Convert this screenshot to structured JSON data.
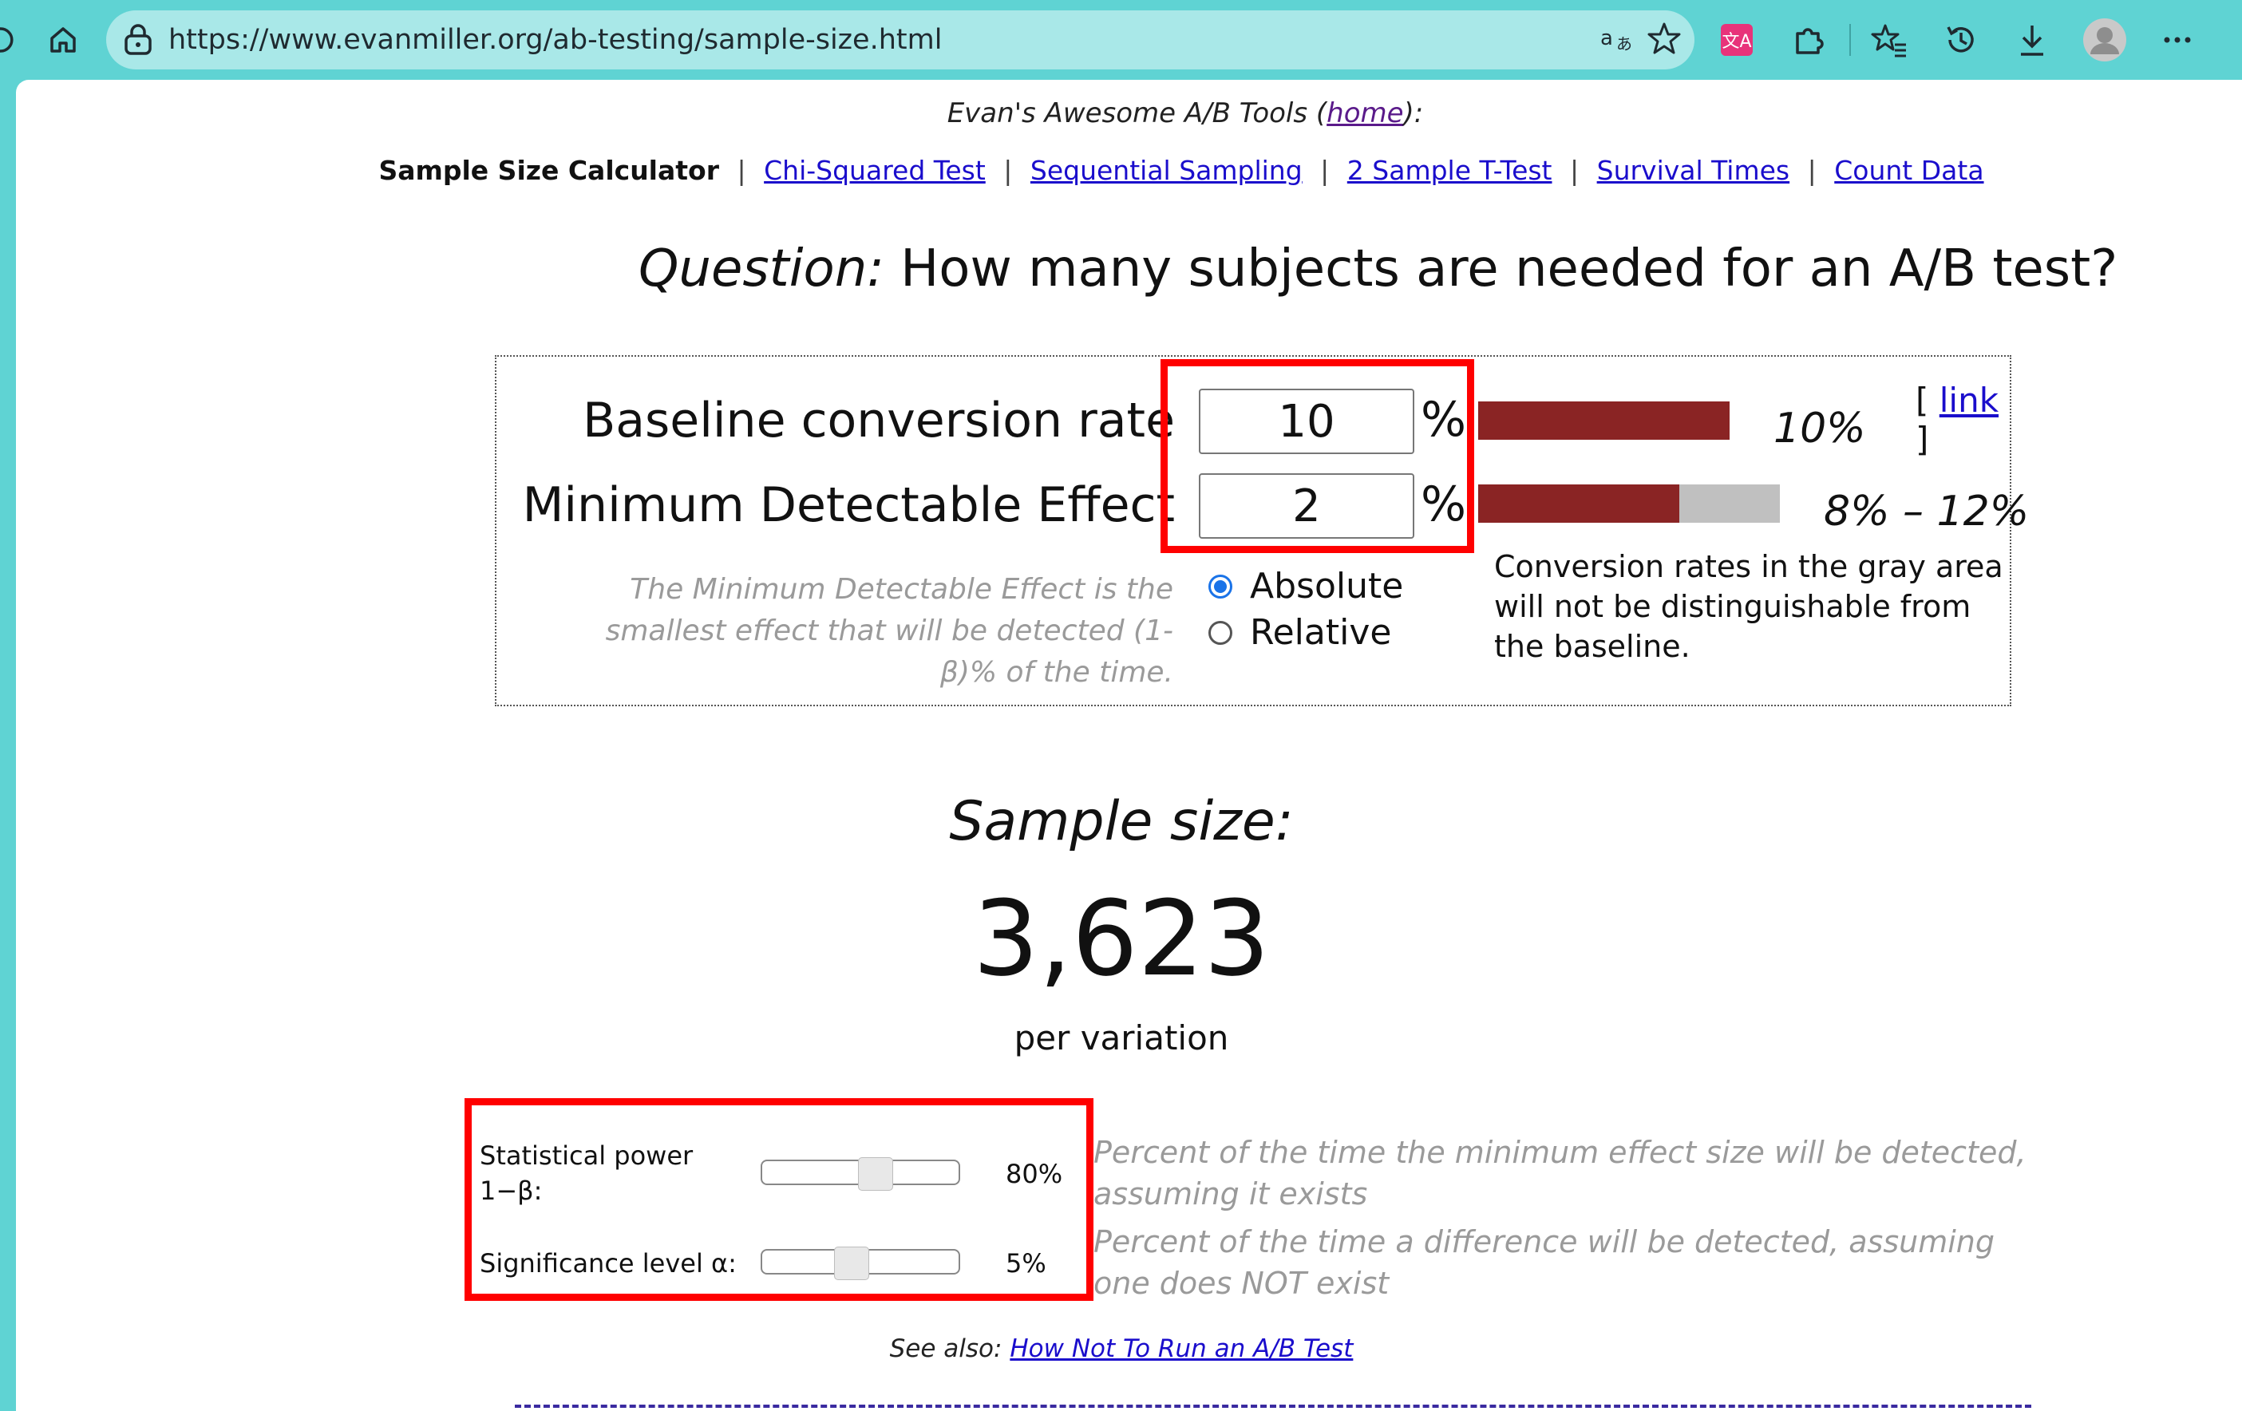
{
  "browser": {
    "url": "https://www.evanmiller.org/ab-testing/sample-size.html",
    "extension_badge": "文A"
  },
  "header": {
    "site_title_pre": "Evan's Awesome A/B Tools (",
    "site_title_link": "home",
    "site_title_post": "):"
  },
  "nav": {
    "current": "Sample Size Calculator",
    "separator": "|",
    "links": [
      "Chi-Squared Test",
      "Sequential Sampling",
      "2 Sample T-Test",
      "Survival Times",
      "Count Data"
    ]
  },
  "question": {
    "prefix": "Question:",
    "text": " How many subjects are needed for an A/B test?"
  },
  "calculator": {
    "baseline_label": "Baseline conversion rate",
    "baseline_value": "10",
    "mde_label": "Minimum Detectable Effect",
    "mde_value": "2",
    "percent_sign": "%",
    "baseline_bar_range": "10%",
    "mde_bar_range": "8% – 12%",
    "link_open": "[ ",
    "link_text": "link",
    "link_close": " ]",
    "mde_hint": "The Minimum Detectable Effect is the smallest effect that will be detected (1-β)% of the time.",
    "mode_options": [
      "Absolute",
      "Relative"
    ],
    "mode_selected": "Absolute",
    "gray_note": "Conversion rates in the gray area will not be distinguishable from the baseline.",
    "colors": {
      "bar_red": "#8a2424",
      "bar_gray": "#c0c0c0"
    }
  },
  "result": {
    "title": "Sample size:",
    "value": "3,623",
    "unit": "per variation"
  },
  "parameters": {
    "power_label_line1": "Statistical power",
    "power_label_line2": "1−β:",
    "power_value": "80%",
    "power_desc": "Percent of the time the minimum effect size will be detected, assuming it exists",
    "alpha_label": "Significance level α:",
    "alpha_value": "5%",
    "alpha_desc": "Percent of the time a difference will be detected, assuming one does NOT exist"
  },
  "footer": {
    "see_also_label": "See also: ",
    "see_also_link": "How Not To Run an A/B Test"
  },
  "annotations": {
    "highlight_color": "#ff0000"
  }
}
